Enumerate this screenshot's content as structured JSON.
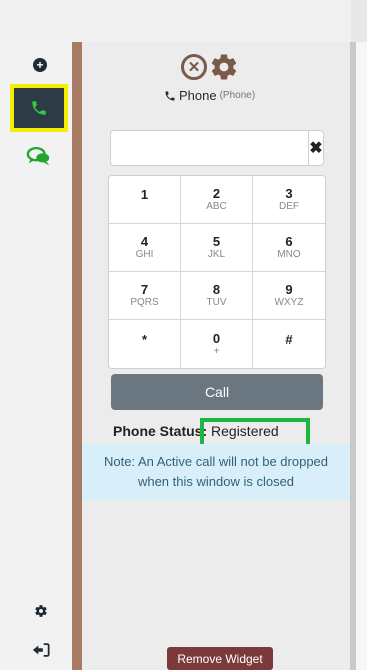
{
  "sidebar": {
    "icons": [
      "plus-circle-icon",
      "phone-icon",
      "chat-icon",
      "gear-icon",
      "sign-out-icon"
    ]
  },
  "header": {
    "title": "Phone",
    "subtitle": "(Phone)"
  },
  "dialer": {
    "input_value": "",
    "clear_icon": "✖",
    "keys": [
      {
        "digit": "1",
        "letters": ""
      },
      {
        "digit": "2",
        "letters": "ABC"
      },
      {
        "digit": "3",
        "letters": "DEF"
      },
      {
        "digit": "4",
        "letters": "GHI"
      },
      {
        "digit": "5",
        "letters": "JKL"
      },
      {
        "digit": "6",
        "letters": "MNO"
      },
      {
        "digit": "7",
        "letters": "PQRS"
      },
      {
        "digit": "8",
        "letters": "TUV"
      },
      {
        "digit": "9",
        "letters": "WXYZ"
      },
      {
        "digit": "*",
        "letters": ""
      },
      {
        "digit": "0",
        "letters": "+"
      },
      {
        "digit": "#",
        "letters": ""
      }
    ],
    "call_label": "Call"
  },
  "status": {
    "label": "Phone Status:",
    "value": "Registered"
  },
  "note": "Note: An Active call will not be dropped when this window is closed",
  "footer": {
    "remove_label": "Remove Widget"
  },
  "colors": {
    "accent_bar": "#a87a64",
    "call_button": "#6a7680",
    "highlight_yellow": "#f5ee00",
    "highlight_green": "#1db544",
    "note_bg": "#d8eef8",
    "remove_button": "#7b3a3a"
  }
}
